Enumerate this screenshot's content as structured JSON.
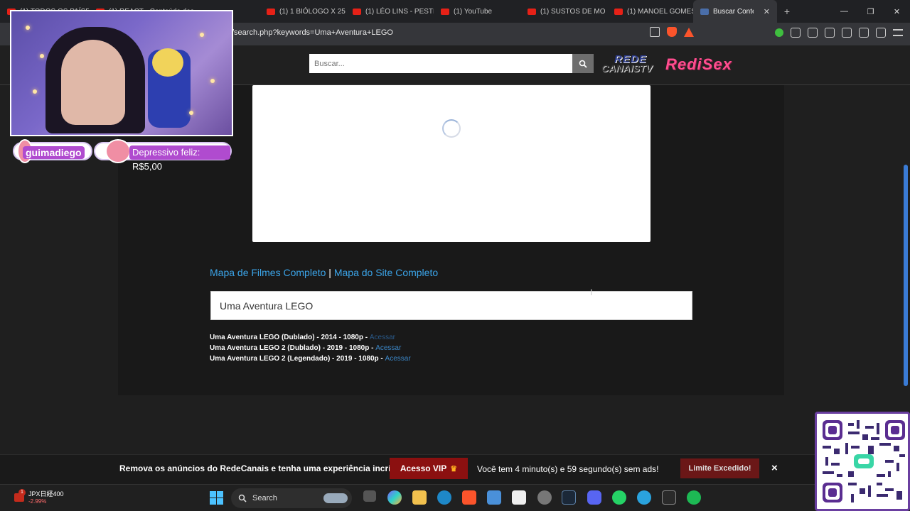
{
  "browser": {
    "tabs": [
      {
        "title": "(1) TODOS OS PAÍSES",
        "type": "youtube"
      },
      {
        "title": "(1) REACT - Conteúdo dos",
        "type": "youtube"
      },
      {
        "title": "(1) 1 BIÓLOGO X 25",
        "type": "youtube"
      },
      {
        "title": "(1) LÉO LINS - PESTE",
        "type": "youtube"
      },
      {
        "title": "(1) YouTube",
        "type": "youtube"
      },
      {
        "title": "(1) SUSTOS DE MO",
        "type": "youtube"
      },
      {
        "title": "(1) MANOEL GOMES",
        "type": "youtube"
      },
      {
        "title": "Buscar Conteúdo",
        "type": "site",
        "active": true
      }
    ],
    "url": "/search.php?keywords=Uma+Aventura+LEGO",
    "brave_badge": "2",
    "rewards_badge": "1"
  },
  "site": {
    "search_placeholder": "Buscar...",
    "logo_line1": "REDE",
    "logo_line2": "CANAISTV",
    "logo_line3": "RediSex"
  },
  "content": {
    "map_films_link": "Mapa de Filmes Completo",
    "separator": " | ",
    "map_site_link": "Mapa do Site Completo",
    "query": "Uma Aventura LEGO",
    "results": [
      {
        "title": "Uma Aventura LEGO (Dublado) - 2014 - 1080p - ",
        "link": "Acessar"
      },
      {
        "title": "Uma Aventura LEGO 2 (Dublado) - 2019 - 1080p - ",
        "link": "Acessar"
      },
      {
        "title": "Uma Aventura LEGO 2 (Legendado) - 2019 - 1080p - ",
        "link": "Acessar"
      }
    ]
  },
  "adbar": {
    "message": "Remova os anúncios do RedeCanais e tenha uma experiência incrível!",
    "vip_button": "Acesso VIP",
    "timer": "Você tem 4 minuto(s) e 59 segundo(s) sem ads!",
    "limit_button": "Limite Excedido!",
    "close": "×"
  },
  "overlay": {
    "username": "guimadiego",
    "donation": "Depressivo feliz: R$5,00"
  },
  "taskbar": {
    "stock_name": "JPX日経400",
    "stock_change": "-2.99%",
    "stock_badge": "1",
    "search_label": "Search"
  },
  "colors": {
    "accent_link": "#3ba4e8",
    "vip_red": "#8b1010",
    "overlay_purple": "#b04bcf"
  }
}
